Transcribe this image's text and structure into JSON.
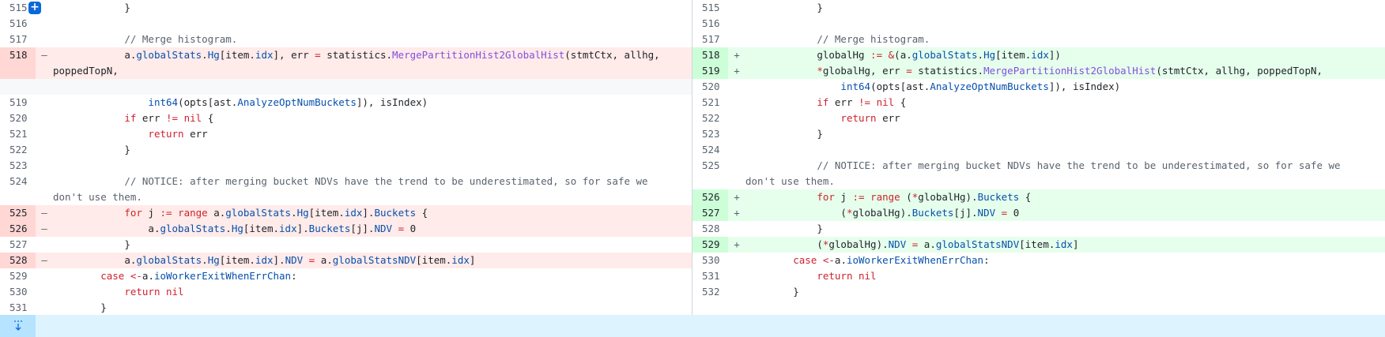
{
  "left": {
    "lines": [
      {
        "num": "515",
        "type": "ctx",
        "code": "\t\t\t}"
      },
      {
        "num": "516",
        "type": "ctx",
        "code": ""
      },
      {
        "num": "517",
        "type": "ctx",
        "code": "\t\t\t// Merge histogram."
      },
      {
        "num": "518",
        "type": "del",
        "code": "\t\t\ta.globalStats.Hg[item.idx], err = statistics.MergePartitionHist2GlobalHist(stmtCtx, allhg, poppedTopN,"
      },
      {
        "num": "",
        "type": "empty",
        "code": ""
      },
      {
        "num": "519",
        "type": "ctx",
        "code": "\t\t\t\tint64(opts[ast.AnalyzeOptNumBuckets]), isIndex)"
      },
      {
        "num": "520",
        "type": "ctx",
        "code": "\t\t\tif err != nil {"
      },
      {
        "num": "521",
        "type": "ctx",
        "code": "\t\t\t\treturn err"
      },
      {
        "num": "522",
        "type": "ctx",
        "code": "\t\t\t}"
      },
      {
        "num": "523",
        "type": "ctx",
        "code": ""
      },
      {
        "num": "524",
        "type": "ctx",
        "code": "\t\t\t// NOTICE: after merging bucket NDVs have the trend to be underestimated, so for safe we don't use them."
      },
      {
        "num": "525",
        "type": "del",
        "code": "\t\t\tfor j := range a.globalStats.Hg[item.idx].Buckets {"
      },
      {
        "num": "526",
        "type": "del",
        "code": "\t\t\t\ta.globalStats.Hg[item.idx].Buckets[j].NDV = 0"
      },
      {
        "num": "527",
        "type": "ctx",
        "code": "\t\t\t}"
      },
      {
        "num": "528",
        "type": "del",
        "code": "\t\t\ta.globalStats.Hg[item.idx].NDV = a.globalStatsNDV[item.idx]"
      },
      {
        "num": "529",
        "type": "ctx",
        "code": "\t\tcase <-a.ioWorkerExitWhenErrChan:"
      },
      {
        "num": "530",
        "type": "ctx",
        "code": "\t\t\treturn nil"
      },
      {
        "num": "531",
        "type": "ctx",
        "code": "\t\t}"
      }
    ]
  },
  "right": {
    "lines": [
      {
        "num": "515",
        "type": "ctx",
        "code": "\t\t\t}"
      },
      {
        "num": "516",
        "type": "ctx",
        "code": ""
      },
      {
        "num": "517",
        "type": "ctx",
        "code": "\t\t\t// Merge histogram."
      },
      {
        "num": "518",
        "type": "add",
        "code": "\t\t\tglobalHg := &(a.globalStats.Hg[item.idx])"
      },
      {
        "num": "519",
        "type": "add",
        "code": "\t\t\t*globalHg, err = statistics.MergePartitionHist2GlobalHist(stmtCtx, allhg, poppedTopN,"
      },
      {
        "num": "520",
        "type": "ctx",
        "code": "\t\t\t\tint64(opts[ast.AnalyzeOptNumBuckets]), isIndex)"
      },
      {
        "num": "521",
        "type": "ctx",
        "code": "\t\t\tif err != nil {"
      },
      {
        "num": "522",
        "type": "ctx",
        "code": "\t\t\t\treturn err"
      },
      {
        "num": "523",
        "type": "ctx",
        "code": "\t\t\t}"
      },
      {
        "num": "524",
        "type": "ctx",
        "code": ""
      },
      {
        "num": "525",
        "type": "ctx",
        "code": "\t\t\t// NOTICE: after merging bucket NDVs have the trend to be underestimated, so for safe we don't use them."
      },
      {
        "num": "526",
        "type": "add",
        "code": "\t\t\tfor j := range (*globalHg).Buckets {"
      },
      {
        "num": "527",
        "type": "add",
        "code": "\t\t\t\t(*globalHg).Buckets[j].NDV = 0"
      },
      {
        "num": "528",
        "type": "ctx",
        "code": "\t\t\t}"
      },
      {
        "num": "529",
        "type": "add",
        "code": "\t\t\t(*globalHg).NDV = a.globalStatsNDV[item.idx]"
      },
      {
        "num": "530",
        "type": "ctx",
        "code": "\t\tcase <-a.ioWorkerExitWhenErrChan:"
      },
      {
        "num": "531",
        "type": "ctx",
        "code": "\t\t\treturn nil"
      },
      {
        "num": "532",
        "type": "ctx",
        "code": "\t\t}"
      }
    ]
  },
  "markers": {
    "del": "–",
    "add": "+"
  },
  "icons": {
    "add_comment": "plus-icon",
    "expand": "expand-down-icon"
  },
  "colors": {
    "del_bg": "#ffebe9",
    "add_bg": "#e6ffec",
    "accent": "#0969da"
  }
}
